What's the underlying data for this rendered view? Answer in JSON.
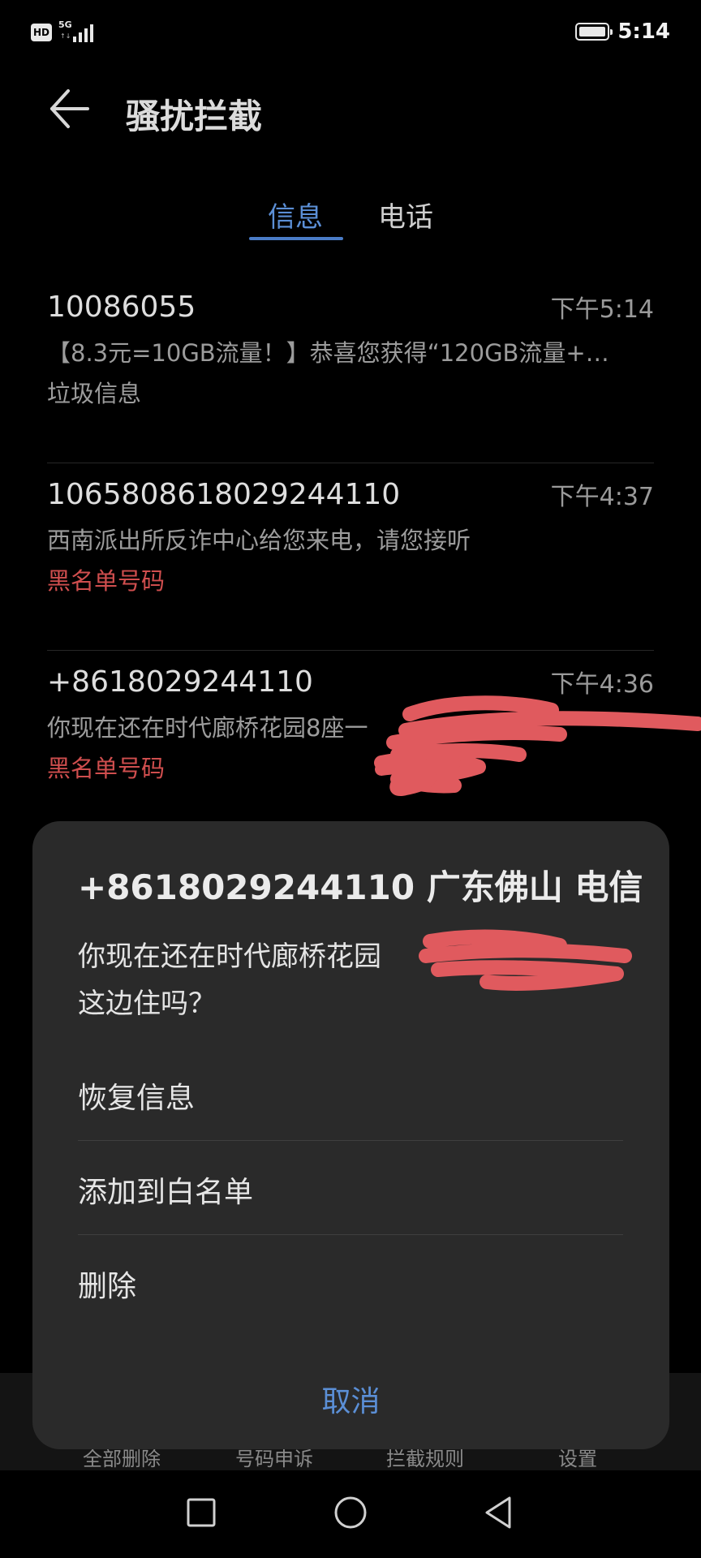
{
  "status_bar": {
    "hd": "HD",
    "network": "5G",
    "network_sub": "↑↓",
    "time": "5:14"
  },
  "header": {
    "title": "骚扰拦截",
    "back_icon": "arrow-left-icon"
  },
  "tabs": [
    {
      "label": "信息",
      "active": true
    },
    {
      "label": "电话",
      "active": false
    }
  ],
  "messages": [
    {
      "sender": "10086055",
      "time": "下午5:14",
      "preview": "【8.3元=10GB流量！】恭喜您获得“120GB流量+…",
      "tag": "垃圾信息",
      "tag_type": "junk"
    },
    {
      "sender": "1065808618029244110",
      "time": "下午4:37",
      "preview": "西南派出所反诈中心给您来电，请您接听",
      "tag": "黑名单号码",
      "tag_type": "blacklist"
    },
    {
      "sender": "+8618029244110",
      "time": "下午4:36",
      "preview": "你现在还在时代廊桥花园8座一",
      "tag": "黑名单号码",
      "tag_type": "blacklist"
    }
  ],
  "toolbar": {
    "items": [
      "全部删除",
      "号码申诉",
      "拦截规则",
      "设置"
    ]
  },
  "sheet": {
    "title": "+8618029244110 广东佛山 电信",
    "body_line1": "你现在还在时代廊桥花园",
    "body_line2": "这边住吗？",
    "actions": [
      "恢复信息",
      "添加到白名单",
      "删除"
    ],
    "cancel": "取消"
  },
  "colors": {
    "accent": "#5b8fd6",
    "blacklist": "#cf4e4e",
    "sheet_bg": "#2a2a2a",
    "redaction": "#e05a5e"
  },
  "nav_icons": [
    "square-recent-icon",
    "circle-home-icon",
    "triangle-back-icon"
  ]
}
